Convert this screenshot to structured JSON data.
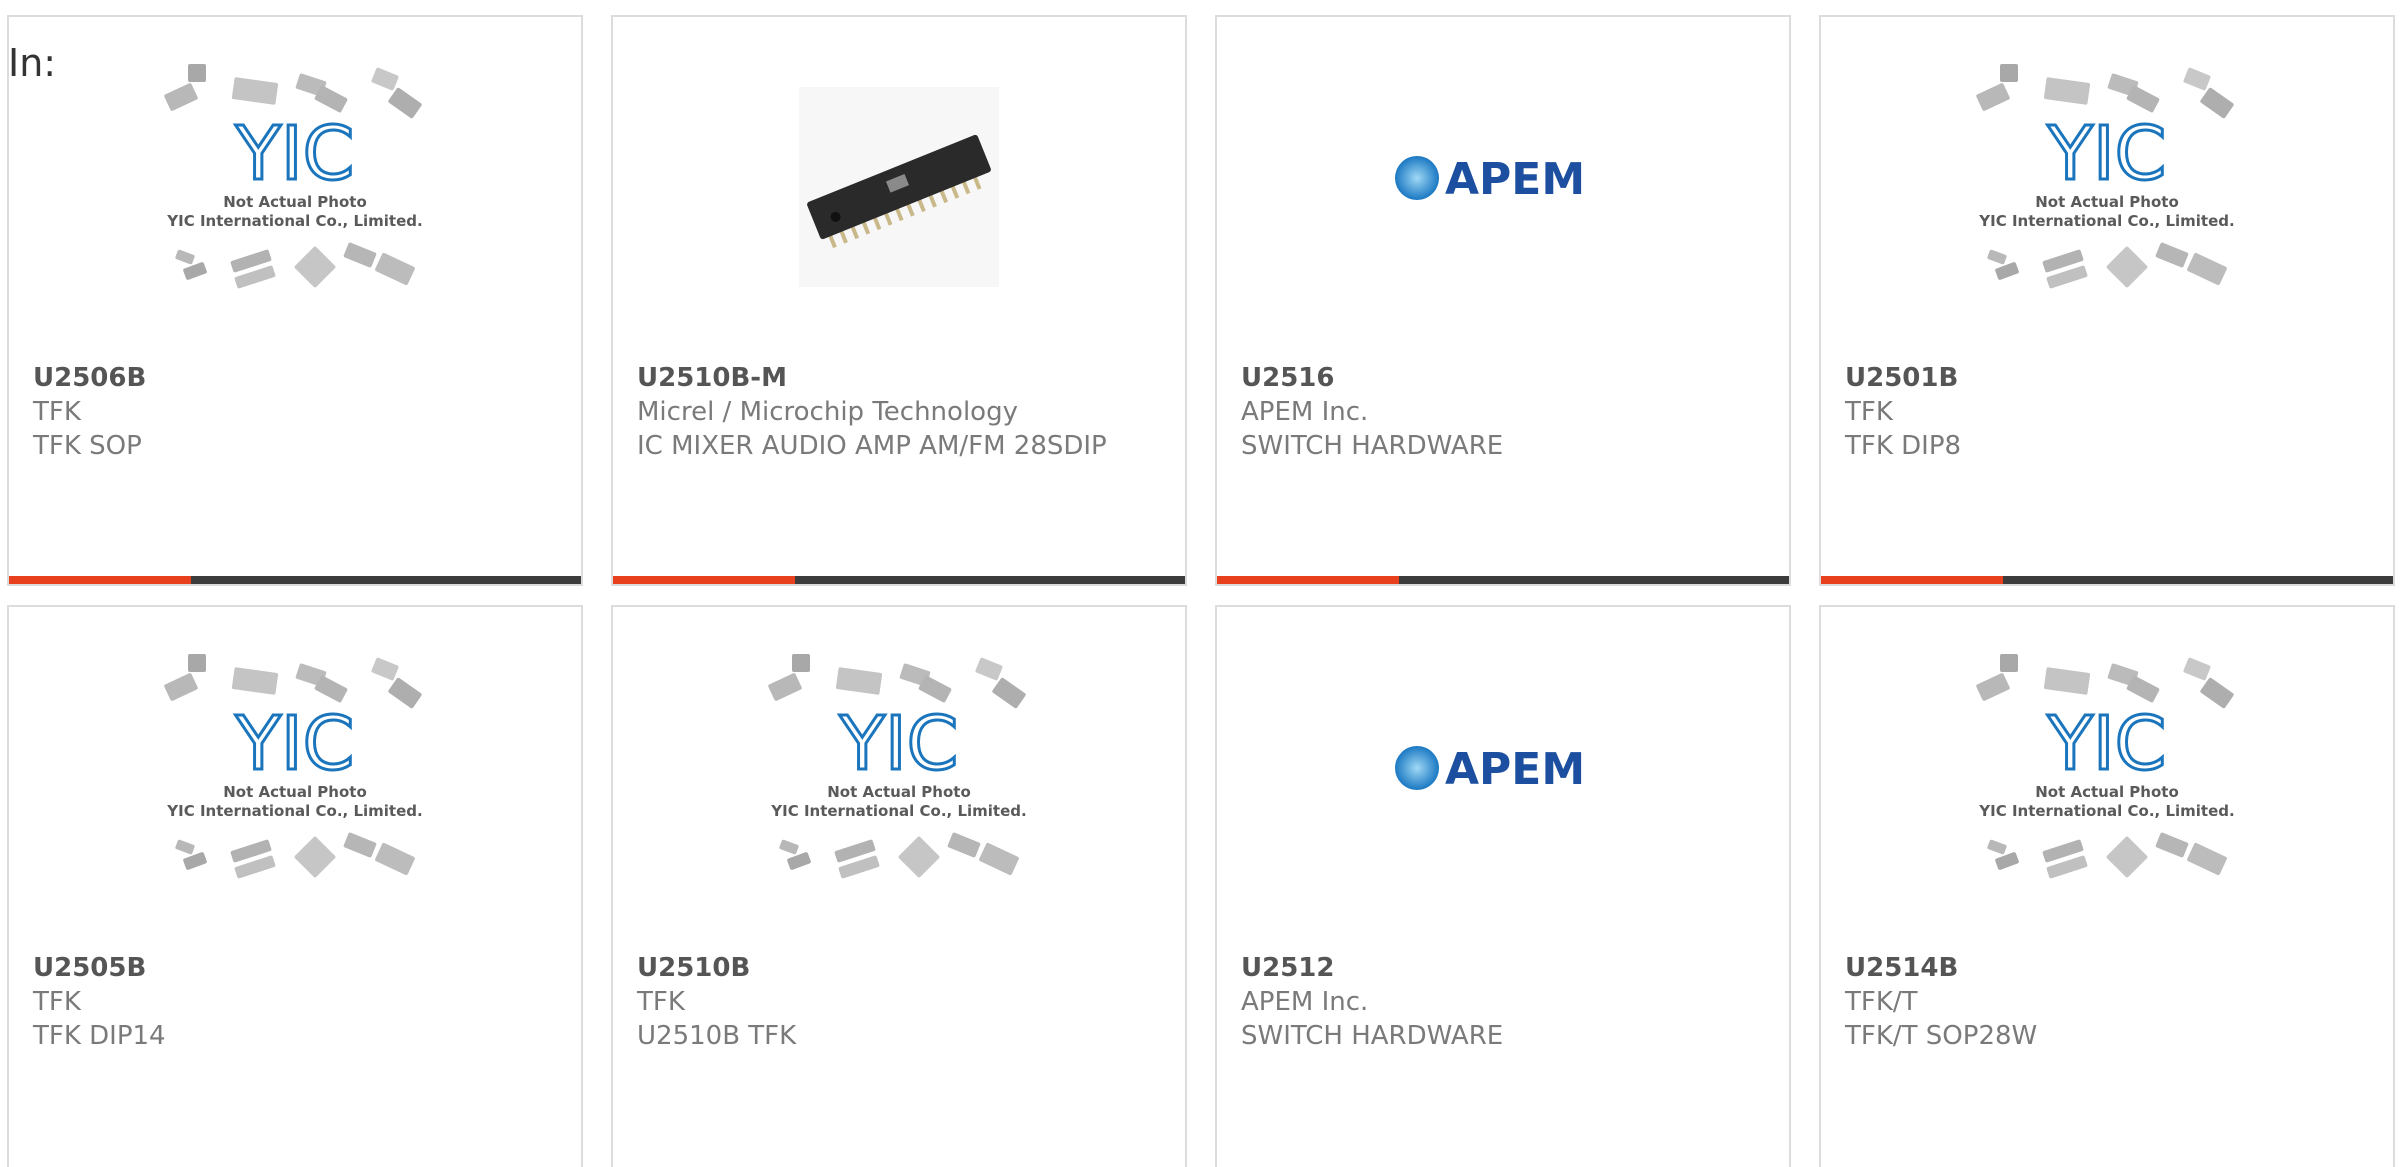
{
  "filter_label": "In:",
  "colors": {
    "accent": "#e8401c",
    "bar_dark": "#3c3c3c",
    "yic_logo": "#1b75bc",
    "apem_logo": "#1c4fa0"
  },
  "products": [
    {
      "part_number": "U2506B",
      "manufacturer": "TFK",
      "description": "TFK SOP",
      "image": "yic-placeholder",
      "placeholder_caption": [
        "Not Actual Photo",
        "YIC International Co., Limited."
      ]
    },
    {
      "part_number": "U2510B-M",
      "manufacturer": "Micrel / Microchip Technology",
      "description": "IC MIXER AUDIO AMP AM/FM 28SDIP",
      "image": "ic-chip-photo"
    },
    {
      "part_number": "U2516",
      "manufacturer": "APEM Inc.",
      "description": "SWITCH HARDWARE",
      "image": "apem-logo",
      "logo_text": "APEM"
    },
    {
      "part_number": "U2501B",
      "manufacturer": "TFK",
      "description": "TFK DIP8",
      "image": "yic-placeholder",
      "placeholder_caption": [
        "Not Actual Photo",
        "YIC International Co., Limited."
      ]
    },
    {
      "part_number": "U2505B",
      "manufacturer": "TFK",
      "description": "TFK DIP14",
      "image": "yic-placeholder",
      "placeholder_caption": [
        "Not Actual Photo",
        "YIC International Co., Limited."
      ]
    },
    {
      "part_number": "U2510B",
      "manufacturer": "TFK",
      "description": "U2510B TFK",
      "image": "yic-placeholder",
      "placeholder_caption": [
        "Not Actual Photo",
        "YIC International Co., Limited."
      ]
    },
    {
      "part_number": "U2512",
      "manufacturer": "APEM Inc.",
      "description": "SWITCH HARDWARE",
      "image": "apem-logo",
      "logo_text": "APEM"
    },
    {
      "part_number": "U2514B",
      "manufacturer": "TFK/T",
      "description": "TFK/T SOP28W",
      "image": "yic-placeholder",
      "placeholder_caption": [
        "Not Actual Photo",
        "YIC International Co., Limited."
      ]
    }
  ]
}
